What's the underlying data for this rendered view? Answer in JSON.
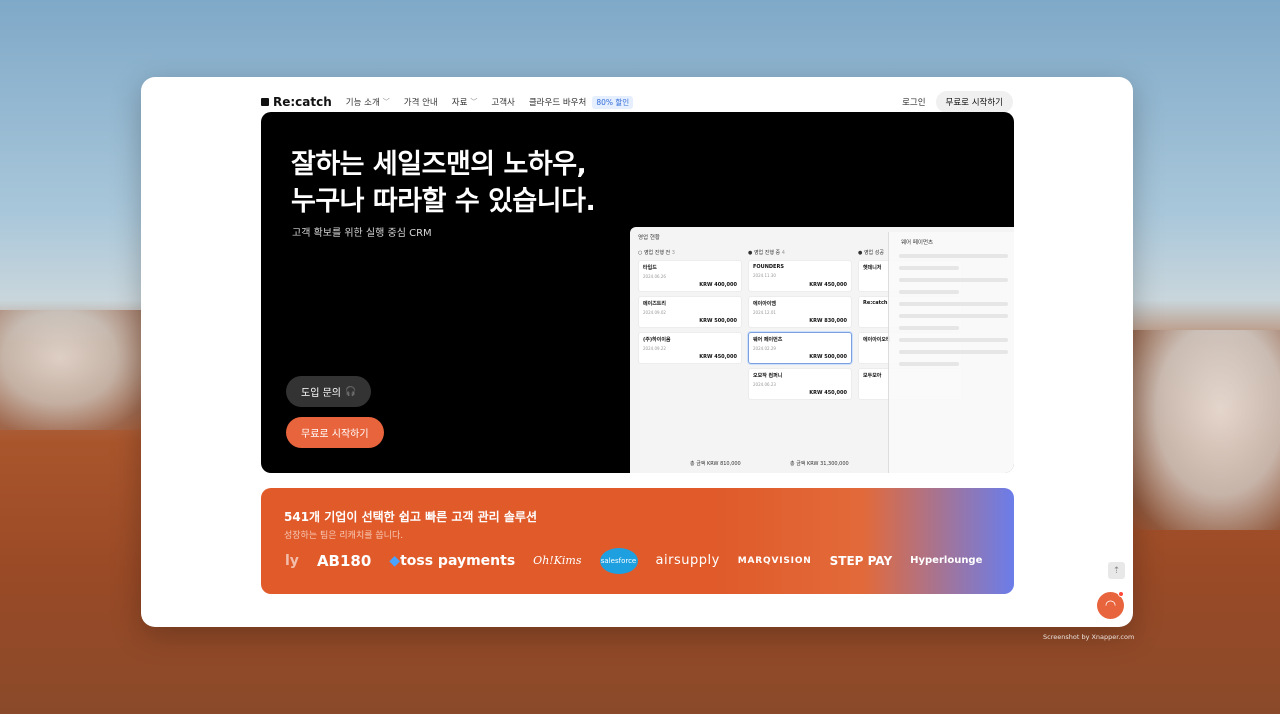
{
  "nav": {
    "logo": "Re:catch",
    "items": [
      {
        "label": "기능 소개",
        "has_dropdown": true
      },
      {
        "label": "가격 안내",
        "has_dropdown": false
      },
      {
        "label": "자료",
        "has_dropdown": true
      },
      {
        "label": "고객사",
        "has_dropdown": false
      },
      {
        "label": "클라우드 바우처",
        "has_dropdown": false
      }
    ],
    "voucher_badge": "80% 할인",
    "login": "로그인",
    "start": "무료로 시작하기"
  },
  "hero": {
    "title_line1": "잘하는 세일즈맨의 노하우,",
    "title_line2": "누구나 따라할 수 있습니다.",
    "subtitle": "고객 확보를 위한 실행 중심 CRM",
    "inquiry_button": "도입 문의",
    "free_button": "무료로 시작하기"
  },
  "board": {
    "title": "영업 현황",
    "columns": [
      {
        "name": "영업 진행 전",
        "count": "3",
        "cards": [
          {
            "name": "타입드",
            "amount": "KRW 400,000",
            "date": "2024.06.26"
          },
          {
            "name": "메이즈트리",
            "amount": "KRW 500,000",
            "date": "2024.09.02"
          },
          {
            "name": "(주)하이이움",
            "amount": "KRW 450,000",
            "date": "2024.09.22"
          }
        ],
        "total": "총 금액 KRW 810,000"
      },
      {
        "name": "영업 진행 중",
        "count": "4",
        "cards": [
          {
            "name": "FOUNDERS",
            "amount": "KRW 450,000",
            "date": "2024.11.30"
          },
          {
            "name": "에이아이엠",
            "amount": "KRW 830,000",
            "date": "2024.12.01"
          },
          {
            "name": "웨어 페이먼츠",
            "amount": "KRW 500,000",
            "date": "2024.02.29",
            "active": true
          },
          {
            "name": "오모작 컴퍼니",
            "amount": "KRW 450,000",
            "date": "2024.06.23"
          }
        ],
        "total": "총 금액 KRW 31,300,000"
      },
      {
        "name": "영업 성공",
        "count": "",
        "cards": [
          {
            "name": "헷데니저",
            "amount": "",
            "date": ""
          },
          {
            "name": "Re:catch",
            "amount": "",
            "date": ""
          },
          {
            "name": "에이아이오티",
            "amount": "",
            "date": ""
          },
          {
            "name": "모두모아",
            "amount": "",
            "date": ""
          }
        ],
        "total": ""
      }
    ],
    "side_panel_title": "웨어 페이먼츠"
  },
  "banner": {
    "title": "541개 기업이 선택한 쉽고 빠른 고객 관리 솔루션",
    "subtitle": "성장하는 팀은 리캐치를 씁니다.",
    "clients": [
      "ly",
      "AB180",
      "toss payments",
      "Oh!Kims",
      "salesforce",
      "airsupply",
      "MARQVISION",
      "STEP PAY",
      "Hyperlounge"
    ]
  },
  "credit": "Screenshot by Xnapper.com",
  "colors": {
    "accent": "#e8643c",
    "banner": "#e05a2a"
  }
}
